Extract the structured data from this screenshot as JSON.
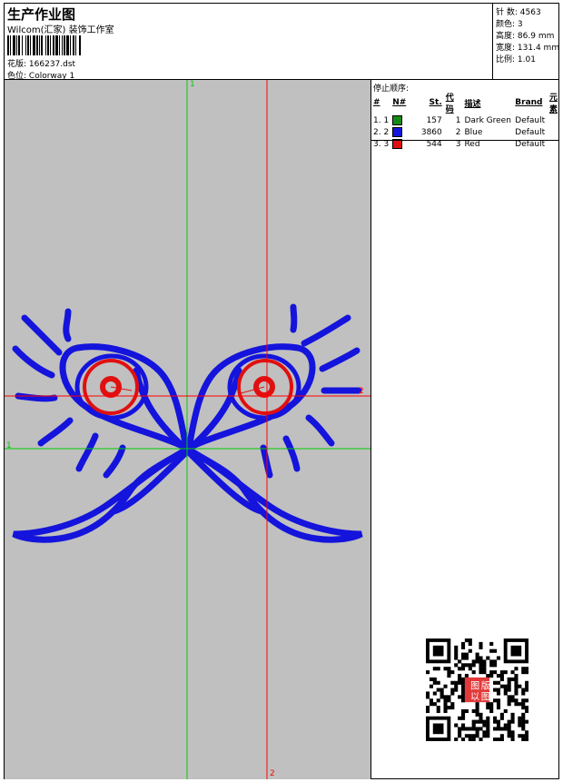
{
  "header": {
    "title": "生产作业图",
    "company": "Wilcom(汇家) 装饰工作室",
    "design_label": "花版:",
    "design_value": "166237.dst",
    "colorway_label": "色位:",
    "colorway_value": "Colorway 1"
  },
  "stats": {
    "stitches_label": "针 数:",
    "stitches_value": "4563",
    "colors_label": "颜色:",
    "colors_value": "3",
    "height_label": "高度:",
    "height_value": "86.9 mm",
    "width_label": "宽度:",
    "width_value": "131.4 mm",
    "scale_label": "比例:",
    "scale_value": "1.01"
  },
  "stop_sequence": {
    "label": "停止顺序:",
    "columns": [
      "#",
      "N#",
      "St.",
      "代码",
      "描述",
      "Brand",
      "元素"
    ],
    "rows": [
      {
        "index": "1. 1",
        "color": "#138a13",
        "stitches": "157",
        "code": "1",
        "description": "Dark Green",
        "brand": "Default"
      },
      {
        "index": "2. 2",
        "color": "#1414dc",
        "stitches": "3860",
        "code": "2",
        "description": "Blue",
        "brand": "Default"
      },
      {
        "index": "3. 3",
        "color": "#e01010",
        "stitches": "544",
        "code": "3",
        "description": "Red",
        "brand": "Default"
      }
    ]
  },
  "canvas": {
    "background": "#c0c0c0",
    "green_guide_color": "#00cc00",
    "red_guide_color": "#ff0000",
    "green_v_label": "1",
    "green_h_label": "1",
    "red_h_label": "2",
    "red_v_label": "2",
    "design_outline_color": "#1414dc",
    "design_eye_color": "#e01010"
  },
  "qr": {
    "stamp_text_1": "图",
    "stamp_text_2": "版",
    "stamp_text_3": "以",
    "stamp_text_4": "图"
  }
}
